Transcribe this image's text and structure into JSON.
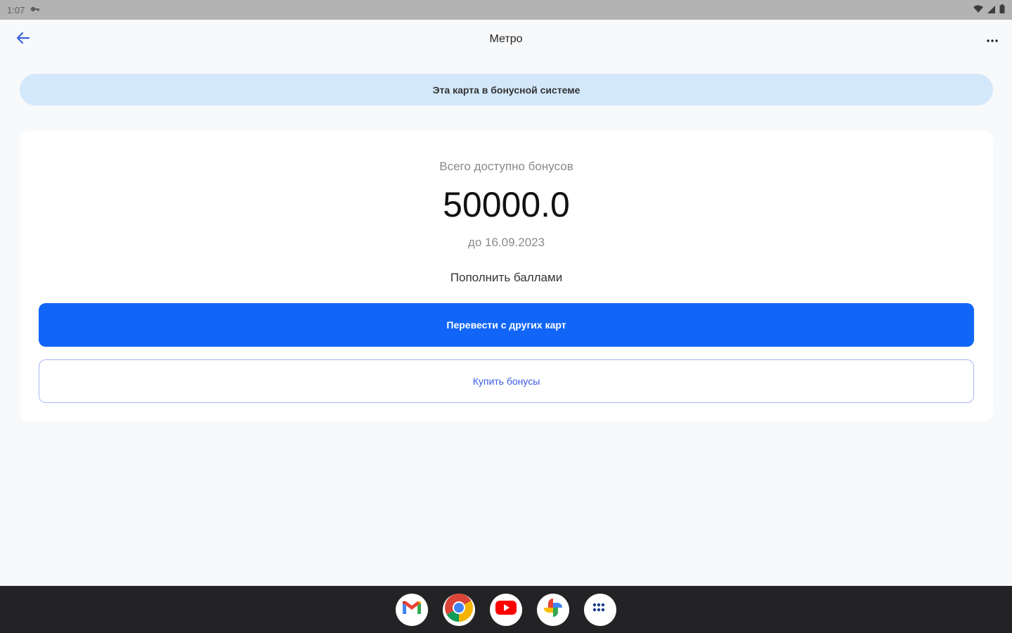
{
  "status_bar": {
    "time": "1:07"
  },
  "app_bar": {
    "title": "Метро"
  },
  "banner": {
    "text": "Эта карта в бонусной системе"
  },
  "bonus_card": {
    "total_label": "Всего доступно бонусов",
    "total_value": "50000.0",
    "expiry": "до 16.09.2023",
    "topup_label": "Пополнить баллами",
    "transfer_button": "Перевести с других карт",
    "buy_button": "Купить бонусы"
  },
  "dock": {
    "apps": [
      "gmail-icon",
      "chrome-icon",
      "youtube-icon",
      "photos-icon",
      "app-drawer-icon"
    ]
  },
  "colors": {
    "primary": "#1166f7",
    "banner_bg": "#d3e8fb",
    "outline": "#a9b6f5",
    "back_arrow": "#3a62e0"
  }
}
